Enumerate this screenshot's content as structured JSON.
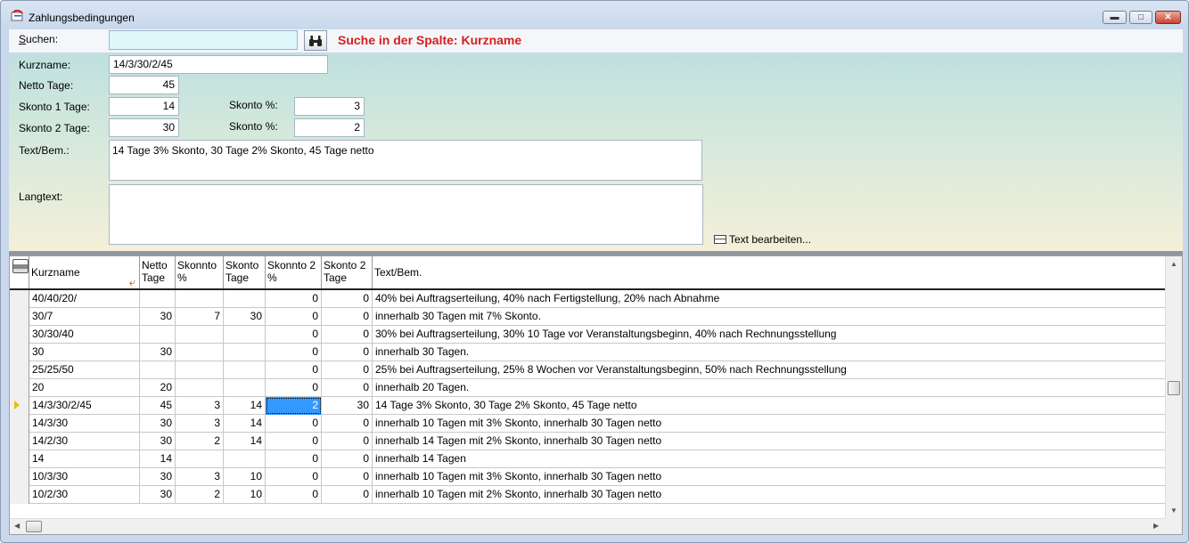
{
  "window": {
    "title": "Zahlungsbedingungen",
    "minimize_icon": "minimize-icon",
    "maximize_icon": "maximize-icon",
    "close_icon": "close-icon"
  },
  "search": {
    "label_underlined": "S",
    "label_rest": "uchen:",
    "value": "",
    "button_icon": "binoculars-icon",
    "hint": "Suche in der Spalte: Kurzname"
  },
  "form": {
    "kurzname_label": "Kurzname:",
    "kurzname_value": "14/3/30/2/45",
    "netto_label": "Netto Tage:",
    "netto_value": "45",
    "skonto1_label": "Skonto 1 Tage:",
    "skonto1_value": "14",
    "skonto1_pct_label": "Skonto %:",
    "skonto1_pct_value": "3",
    "skonto2_label": "Skonto 2 Tage:",
    "skonto2_value": "30",
    "skonto2_pct_label": "Skonto %:",
    "skonto2_pct_value": "2",
    "text_label": "Text/Bem.:",
    "text_value": "14 Tage 3% Skonto, 30 Tage 2% Skonto, 45 Tage netto",
    "langtext_label": "Langtext:",
    "langtext_value": "",
    "edit_text_label": "Text bearbeiten..."
  },
  "grid": {
    "headers": {
      "kurzname": "Kurzname",
      "netto_l1": "Netto",
      "netto_l2": "Tage",
      "skonto_pct_l1": "Skonnto",
      "skonto_pct_l2": "%",
      "skonto_tage_l1": "Skonto",
      "skonto_tage_l2": "Tage",
      "skonto2_pct_l1": "Skonnto 2",
      "skonto2_pct_l2": "%",
      "skonto2_tage_l1": "Skonto 2",
      "skonto2_tage_l2": "Tage",
      "text": "Text/Bem."
    },
    "selected_row": 6,
    "rows": [
      {
        "kurzname": "40/40/20/",
        "netto": "",
        "skonto_pct": "",
        "skonto_tage": "",
        "skonto2_pct": "0",
        "skonto2_tage": "0",
        "text": "40% bei Auftragserteilung, 40% nach Fertigstellung, 20% nach Abnahme"
      },
      {
        "kurzname": "30/7",
        "netto": "30",
        "skonto_pct": "7",
        "skonto_tage": "30",
        "skonto2_pct": "0",
        "skonto2_tage": "0",
        "text": "innerhalb 30 Tagen mit 7% Skonto."
      },
      {
        "kurzname": "30/30/40",
        "netto": "",
        "skonto_pct": "",
        "skonto_tage": "",
        "skonto2_pct": "0",
        "skonto2_tage": "0",
        "text": "30% bei Auftragserteilung, 30% 10 Tage vor Veranstaltungsbeginn, 40% nach Rechnungsstellung"
      },
      {
        "kurzname": "30",
        "netto": "30",
        "skonto_pct": "",
        "skonto_tage": "",
        "skonto2_pct": "0",
        "skonto2_tage": "0",
        "text": "innerhalb 30 Tagen."
      },
      {
        "kurzname": "25/25/50",
        "netto": "",
        "skonto_pct": "",
        "skonto_tage": "",
        "skonto2_pct": "0",
        "skonto2_tage": "0",
        "text": "25% bei Auftragserteilung, 25% 8 Wochen vor Veranstaltungsbeginn, 50% nach Rechnungsstellung"
      },
      {
        "kurzname": "20",
        "netto": "20",
        "skonto_pct": "",
        "skonto_tage": "",
        "skonto2_pct": "0",
        "skonto2_tage": "0",
        "text": "innerhalb 20 Tagen."
      },
      {
        "kurzname": "14/3/30/2/45",
        "netto": "45",
        "skonto_pct": "3",
        "skonto_tage": "14",
        "skonto2_pct": "2",
        "skonto2_tage": "30",
        "text": "14 Tage 3% Skonto, 30 Tage 2% Skonto, 45 Tage netto"
      },
      {
        "kurzname": "14/3/30",
        "netto": "30",
        "skonto_pct": "3",
        "skonto_tage": "14",
        "skonto2_pct": "0",
        "skonto2_tage": "0",
        "text": "innerhalb 10 Tagen mit 3% Skonto, innerhalb 30  Tagen netto"
      },
      {
        "kurzname": "14/2/30",
        "netto": "30",
        "skonto_pct": "2",
        "skonto_tage": "14",
        "skonto2_pct": "0",
        "skonto2_tage": "0",
        "text": "innerhalb 14 Tagen mit 2% Skonto, innerhalb 30 Tagen netto"
      },
      {
        "kurzname": "14",
        "netto": "14",
        "skonto_pct": "",
        "skonto_tage": "",
        "skonto2_pct": "0",
        "skonto2_tage": "0",
        "text": "innerhalb 14 Tagen"
      },
      {
        "kurzname": "10/3/30",
        "netto": "30",
        "skonto_pct": "3",
        "skonto_tage": "10",
        "skonto2_pct": "0",
        "skonto2_tage": "0",
        "text": "innerhalb 10 Tagen mit 3% Skonto, innerhalb 30 Tagen netto"
      },
      {
        "kurzname": "10/2/30",
        "netto": "30",
        "skonto_pct": "2",
        "skonto_tage": "10",
        "skonto2_pct": "0",
        "skonto2_tage": "0",
        "text": "innerhalb 10 Tagen mit 2% Skonto, innerhalb 30 Tagen netto"
      }
    ]
  }
}
